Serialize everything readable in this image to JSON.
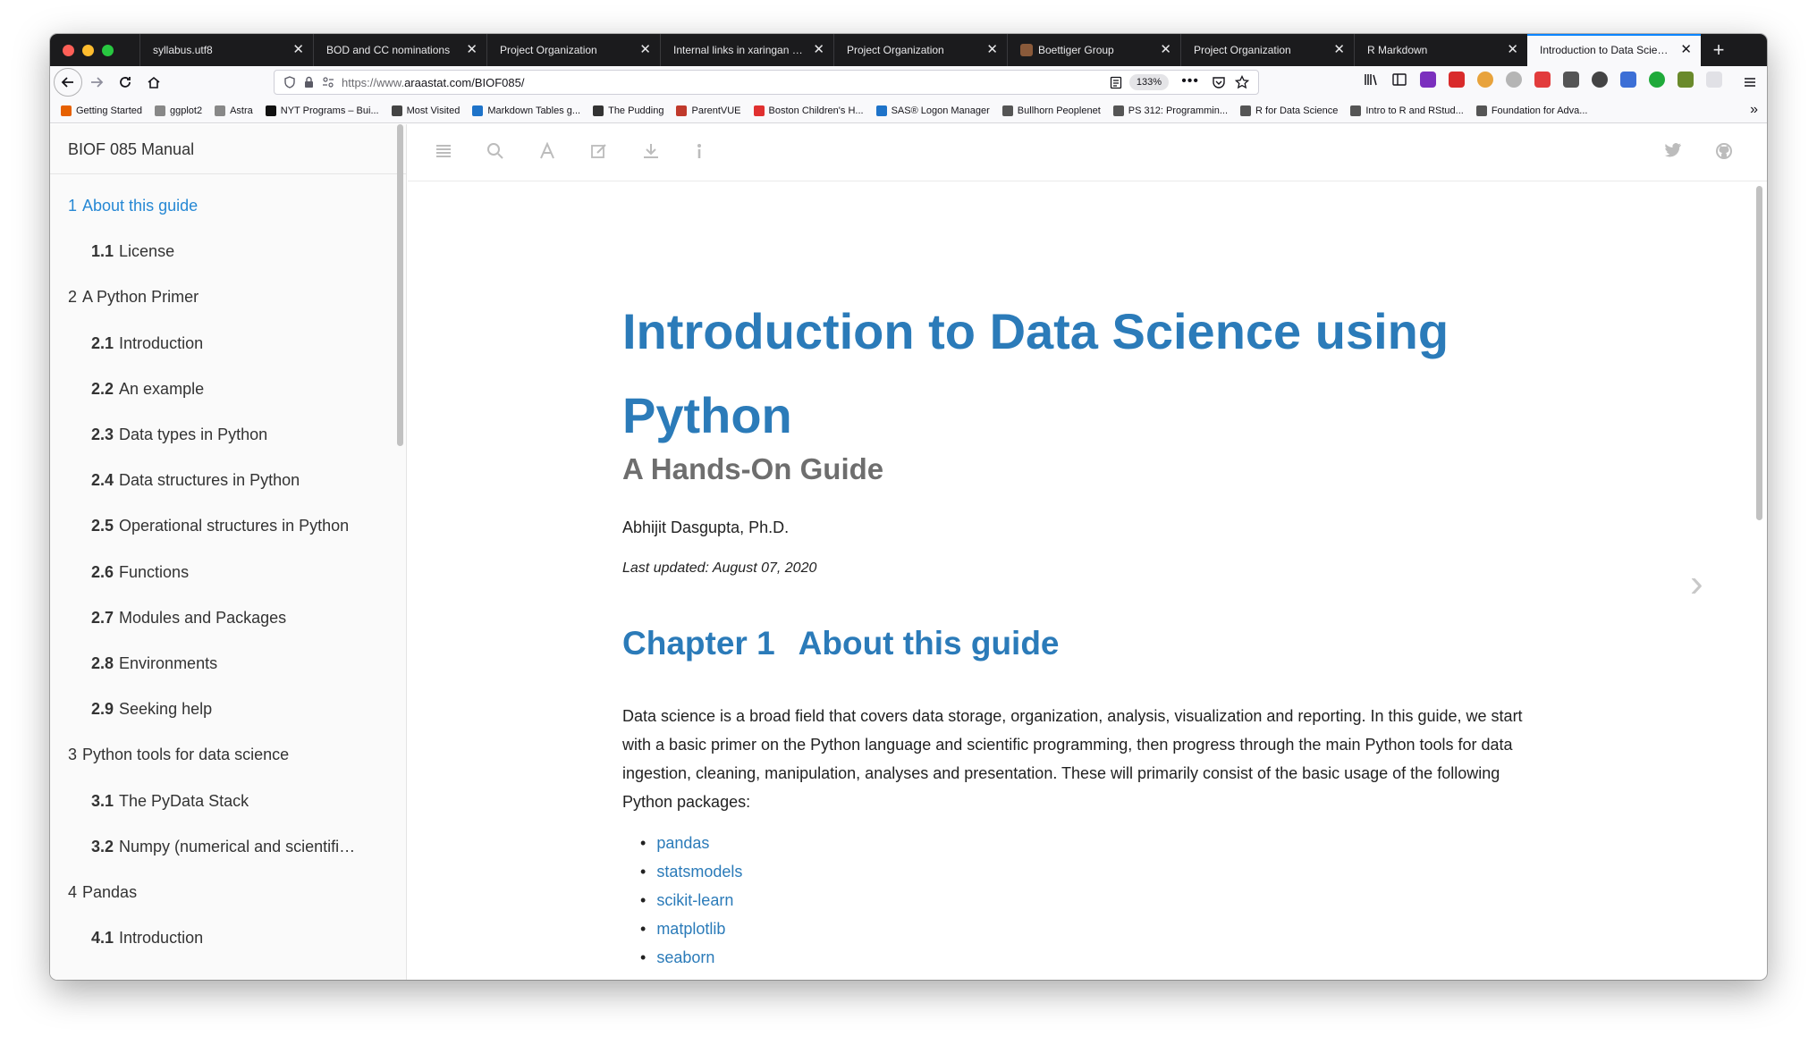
{
  "window": {
    "accent": "#0a84ff"
  },
  "tabs": [
    {
      "label": "syllabus.utf8"
    },
    {
      "label": "BOD and CC nominations"
    },
    {
      "label": "Project Organization"
    },
    {
      "label": "Internal links in xaringan pres"
    },
    {
      "label": "Project Organization"
    },
    {
      "label": "Boettiger Group"
    },
    {
      "label": "Project Organization"
    },
    {
      "label": "R Markdown"
    },
    {
      "label": "Introduction to Data Science"
    }
  ],
  "tab_close": "✕",
  "newtab": "+",
  "nav": {
    "url_proto": "https://www.",
    "url_rest": "araastat.com/BIOF085/",
    "zoom": "133%"
  },
  "bookmarks": [
    {
      "label": "Getting Started",
      "color": "#e66000"
    },
    {
      "label": "ggplot2",
      "color": "#888888"
    },
    {
      "label": "Astra",
      "color": "#888888"
    },
    {
      "label": "NYT Programs – Bui...",
      "color": "#111111"
    },
    {
      "label": "Most Visited",
      "color": "#444444"
    },
    {
      "label": "Markdown Tables g...",
      "color": "#1e73c9"
    },
    {
      "label": "The Pudding",
      "color": "#333333"
    },
    {
      "label": "ParentVUE",
      "color": "#c0392b"
    },
    {
      "label": "Boston Children's H...",
      "color": "#e03030"
    },
    {
      "label": "SAS® Logon Manager",
      "color": "#1e73c9"
    },
    {
      "label": "Bullhorn Peoplenet",
      "color": "#555555"
    },
    {
      "label": "PS 312: Programmin...",
      "color": "#555555"
    },
    {
      "label": "R for Data Science",
      "color": "#555555"
    },
    {
      "label": "Intro to R and RStud...",
      "color": "#555555"
    },
    {
      "label": "Foundation for Adva...",
      "color": "#555555"
    }
  ],
  "sidebar": {
    "title": "BIOF 085 Manual",
    "items": [
      {
        "num": "1",
        "text": "About this guide",
        "level": 1,
        "active": true
      },
      {
        "num": "1.1",
        "text": "License",
        "level": 2
      },
      {
        "num": "2",
        "text": "A Python Primer",
        "level": 1
      },
      {
        "num": "2.1",
        "text": "Introduction",
        "level": 2
      },
      {
        "num": "2.2",
        "text": "An example",
        "level": 2
      },
      {
        "num": "2.3",
        "text": "Data types in Python",
        "level": 2
      },
      {
        "num": "2.4",
        "text": "Data structures in Python",
        "level": 2
      },
      {
        "num": "2.5",
        "text": "Operational structures in Python",
        "level": 2
      },
      {
        "num": "2.6",
        "text": "Functions",
        "level": 2
      },
      {
        "num": "2.7",
        "text": "Modules and Packages",
        "level": 2
      },
      {
        "num": "2.8",
        "text": "Environments",
        "level": 2
      },
      {
        "num": "2.9",
        "text": "Seeking help",
        "level": 2
      },
      {
        "num": "3",
        "text": "Python tools for data science",
        "level": 1
      },
      {
        "num": "3.1",
        "text": "The PyData Stack",
        "level": 2
      },
      {
        "num": "3.2",
        "text": "Numpy (numerical and scientifi…",
        "level": 2
      },
      {
        "num": "4",
        "text": "Pandas",
        "level": 1
      },
      {
        "num": "4.1",
        "text": "Introduction",
        "level": 2
      }
    ]
  },
  "book": {
    "title": "Introduction to Data Science using Python",
    "subtitle": "A Hands-On Guide",
    "author": "Abhijit Dasgupta, Ph.D.",
    "updated": "Last updated: August 07, 2020",
    "chapter_num": "Chapter 1",
    "chapter_title": "About this guide",
    "paragraph": "Data science is a broad field that covers data storage, organization, analysis, visualization and reporting. In this guide, we start with a basic primer on the Python language and scientific programming, then progress through the main Python tools for data ingestion, cleaning, manipulation, analyses and presentation. These will primarily consist of the basic usage of the following Python packages:",
    "packages": [
      "pandas",
      "statsmodels",
      "scikit-learn",
      "matplotlib",
      "seaborn"
    ],
    "next_arrow": "›"
  }
}
